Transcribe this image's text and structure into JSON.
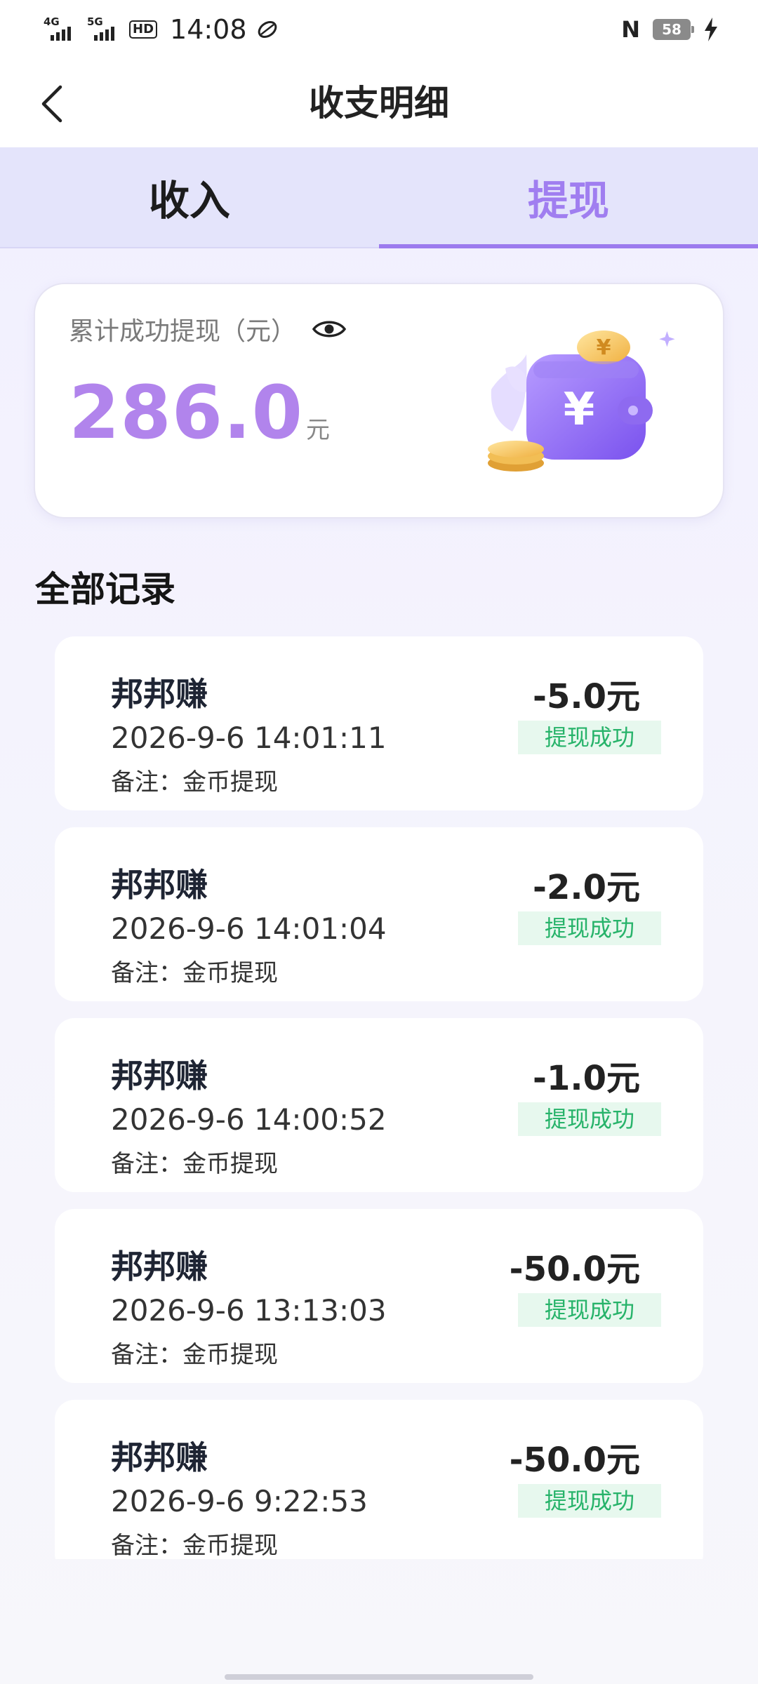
{
  "status_bar": {
    "sim1": "4G",
    "sim2": "5G",
    "hd": "HD",
    "time": "14:08",
    "nfc": "N",
    "battery": "58"
  },
  "nav": {
    "title": "收支明细"
  },
  "tabs": [
    {
      "label": "收入",
      "active": false
    },
    {
      "label": "提现",
      "active": true
    }
  ],
  "summary": {
    "label": "累计成功提现（元）",
    "amount": "286.0",
    "unit": "元"
  },
  "records_title": "全部记录",
  "records": [
    {
      "merchant": "邦邦赚",
      "time": "2026-9-6 14:01:11",
      "note": "备注：金币提现",
      "amount": "-5.0元",
      "status": "提现成功"
    },
    {
      "merchant": "邦邦赚",
      "time": "2026-9-6 14:01:04",
      "note": "备注：金币提现",
      "amount": "-2.0元",
      "status": "提现成功"
    },
    {
      "merchant": "邦邦赚",
      "time": "2026-9-6 14:00:52",
      "note": "备注：金币提现",
      "amount": "-1.0元",
      "status": "提现成功"
    },
    {
      "merchant": "邦邦赚",
      "time": "2026-9-6 13:13:03",
      "note": "备注：金币提现",
      "amount": "-50.0元",
      "status": "提现成功"
    },
    {
      "merchant": "邦邦赚",
      "time": "2026-9-6 9:22:53",
      "note": "备注：金币提现",
      "amount": "-50.0元",
      "status": "提现成功"
    }
  ],
  "colors": {
    "accent": "#a07ef0",
    "amount": "#b184ec",
    "success": "#27b36a"
  }
}
